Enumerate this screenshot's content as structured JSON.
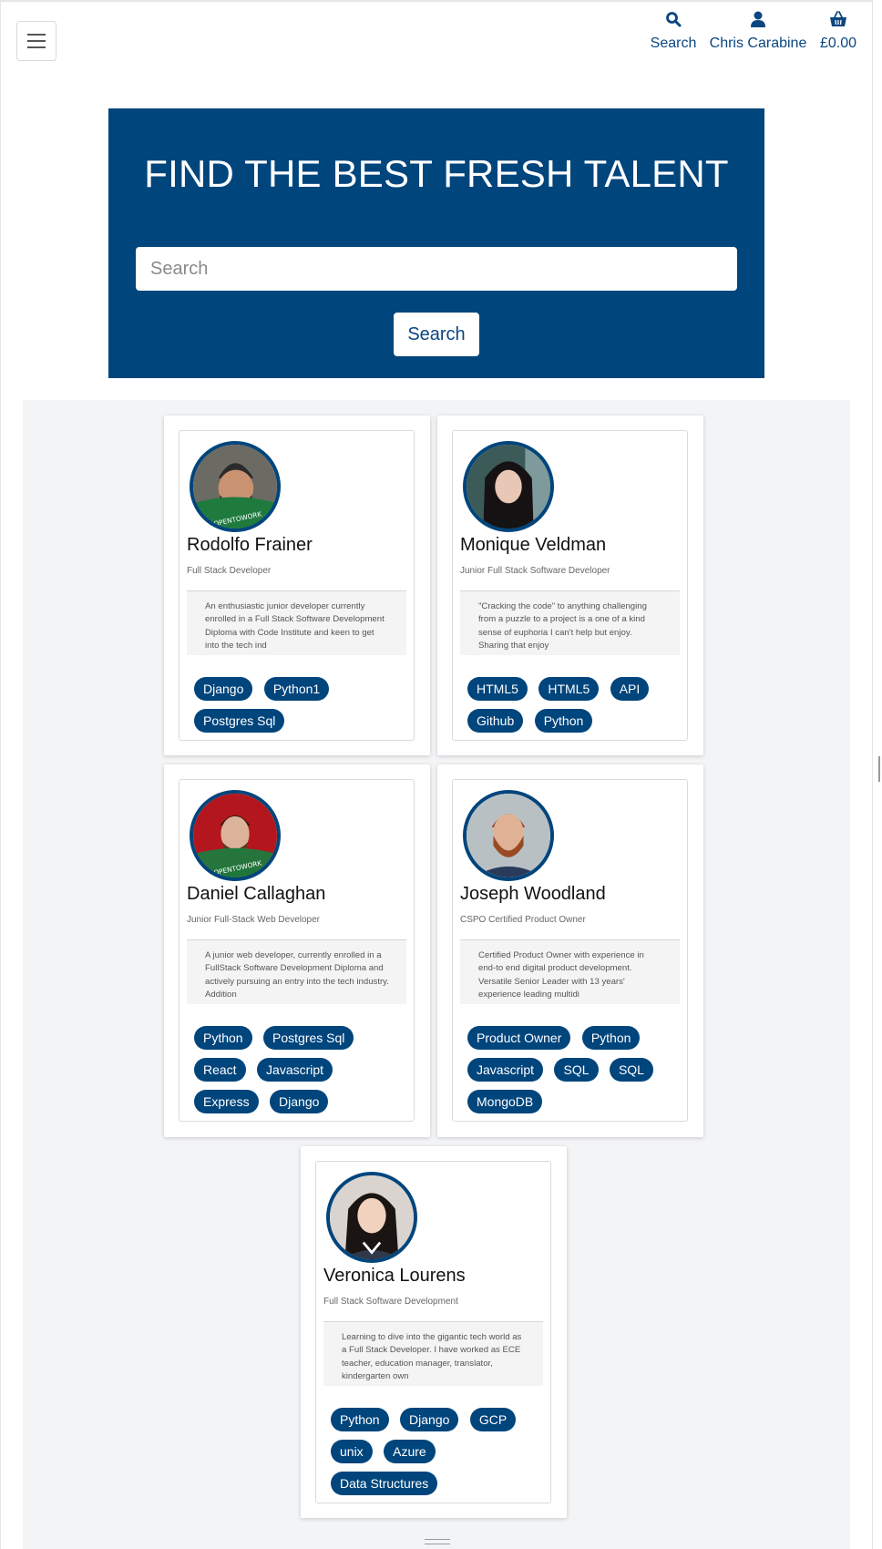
{
  "nav": {
    "search_label": "Search",
    "account_label": "Chris Carabine",
    "bag_label": "£0.00",
    "icons": [
      "menu-icon",
      "search-icon",
      "user-icon",
      "basket-icon"
    ],
    "accent_color": "#0b4680"
  },
  "hero": {
    "title": "FIND THE BEST FRESH TALENT",
    "search_placeholder": "Search",
    "search_button": "Search",
    "background_color": "#00457c"
  },
  "cards": [
    {
      "name": "Rodolfo Frainer",
      "role": "Full Stack Developer",
      "bio": "An enthusiastic junior developer currently enrolled in a Full Stack Software Development Diploma with Code Institute and keen to get into the tech ind",
      "tags": [
        "Django",
        "Python1",
        "Postgres Sql"
      ]
    },
    {
      "name": "Monique Veldman",
      "role": "Junior Full Stack Software Developer",
      "bio": "\"Cracking the code\" to anything challenging from a puzzle to a project is a one of a kind sense of euphoria I can't help but enjoy. Sharing that enjoy",
      "tags": [
        "HTML5",
        "HTML5",
        "API",
        "Github",
        "Python"
      ]
    },
    {
      "name": "Daniel Callaghan",
      "role": "Junior Full-Stack Web Developer",
      "bio": "A junior web developer, currently enrolled in a FullStack Software Development Diploma and actively pursuing an entry into the tech industry. Addition",
      "tags": [
        "Python",
        "Postgres Sql",
        "React",
        "Javascript",
        "Express",
        "Django"
      ]
    },
    {
      "name": "Joseph Woodland",
      "role": "CSPO Certified Product Owner",
      "bio": "Certified Product Owner with experience in end-to end digital product development. Versatile Senior Leader with 13 years' experience leading multidi",
      "tags": [
        "Product Owner",
        "Python",
        "Javascript",
        "SQL",
        "SQL",
        "MongoDB"
      ]
    },
    {
      "name": "Veronica Lourens",
      "role": "Full Stack Software Development",
      "bio": "Learning to dive into the gigantic tech world as a Full Stack Developer. I have worked as ECE teacher, education manager, translator, kindergarten own",
      "tags": [
        "Python",
        "Django",
        "GCP",
        "unix",
        "Azure",
        "Data Structures"
      ]
    }
  ]
}
